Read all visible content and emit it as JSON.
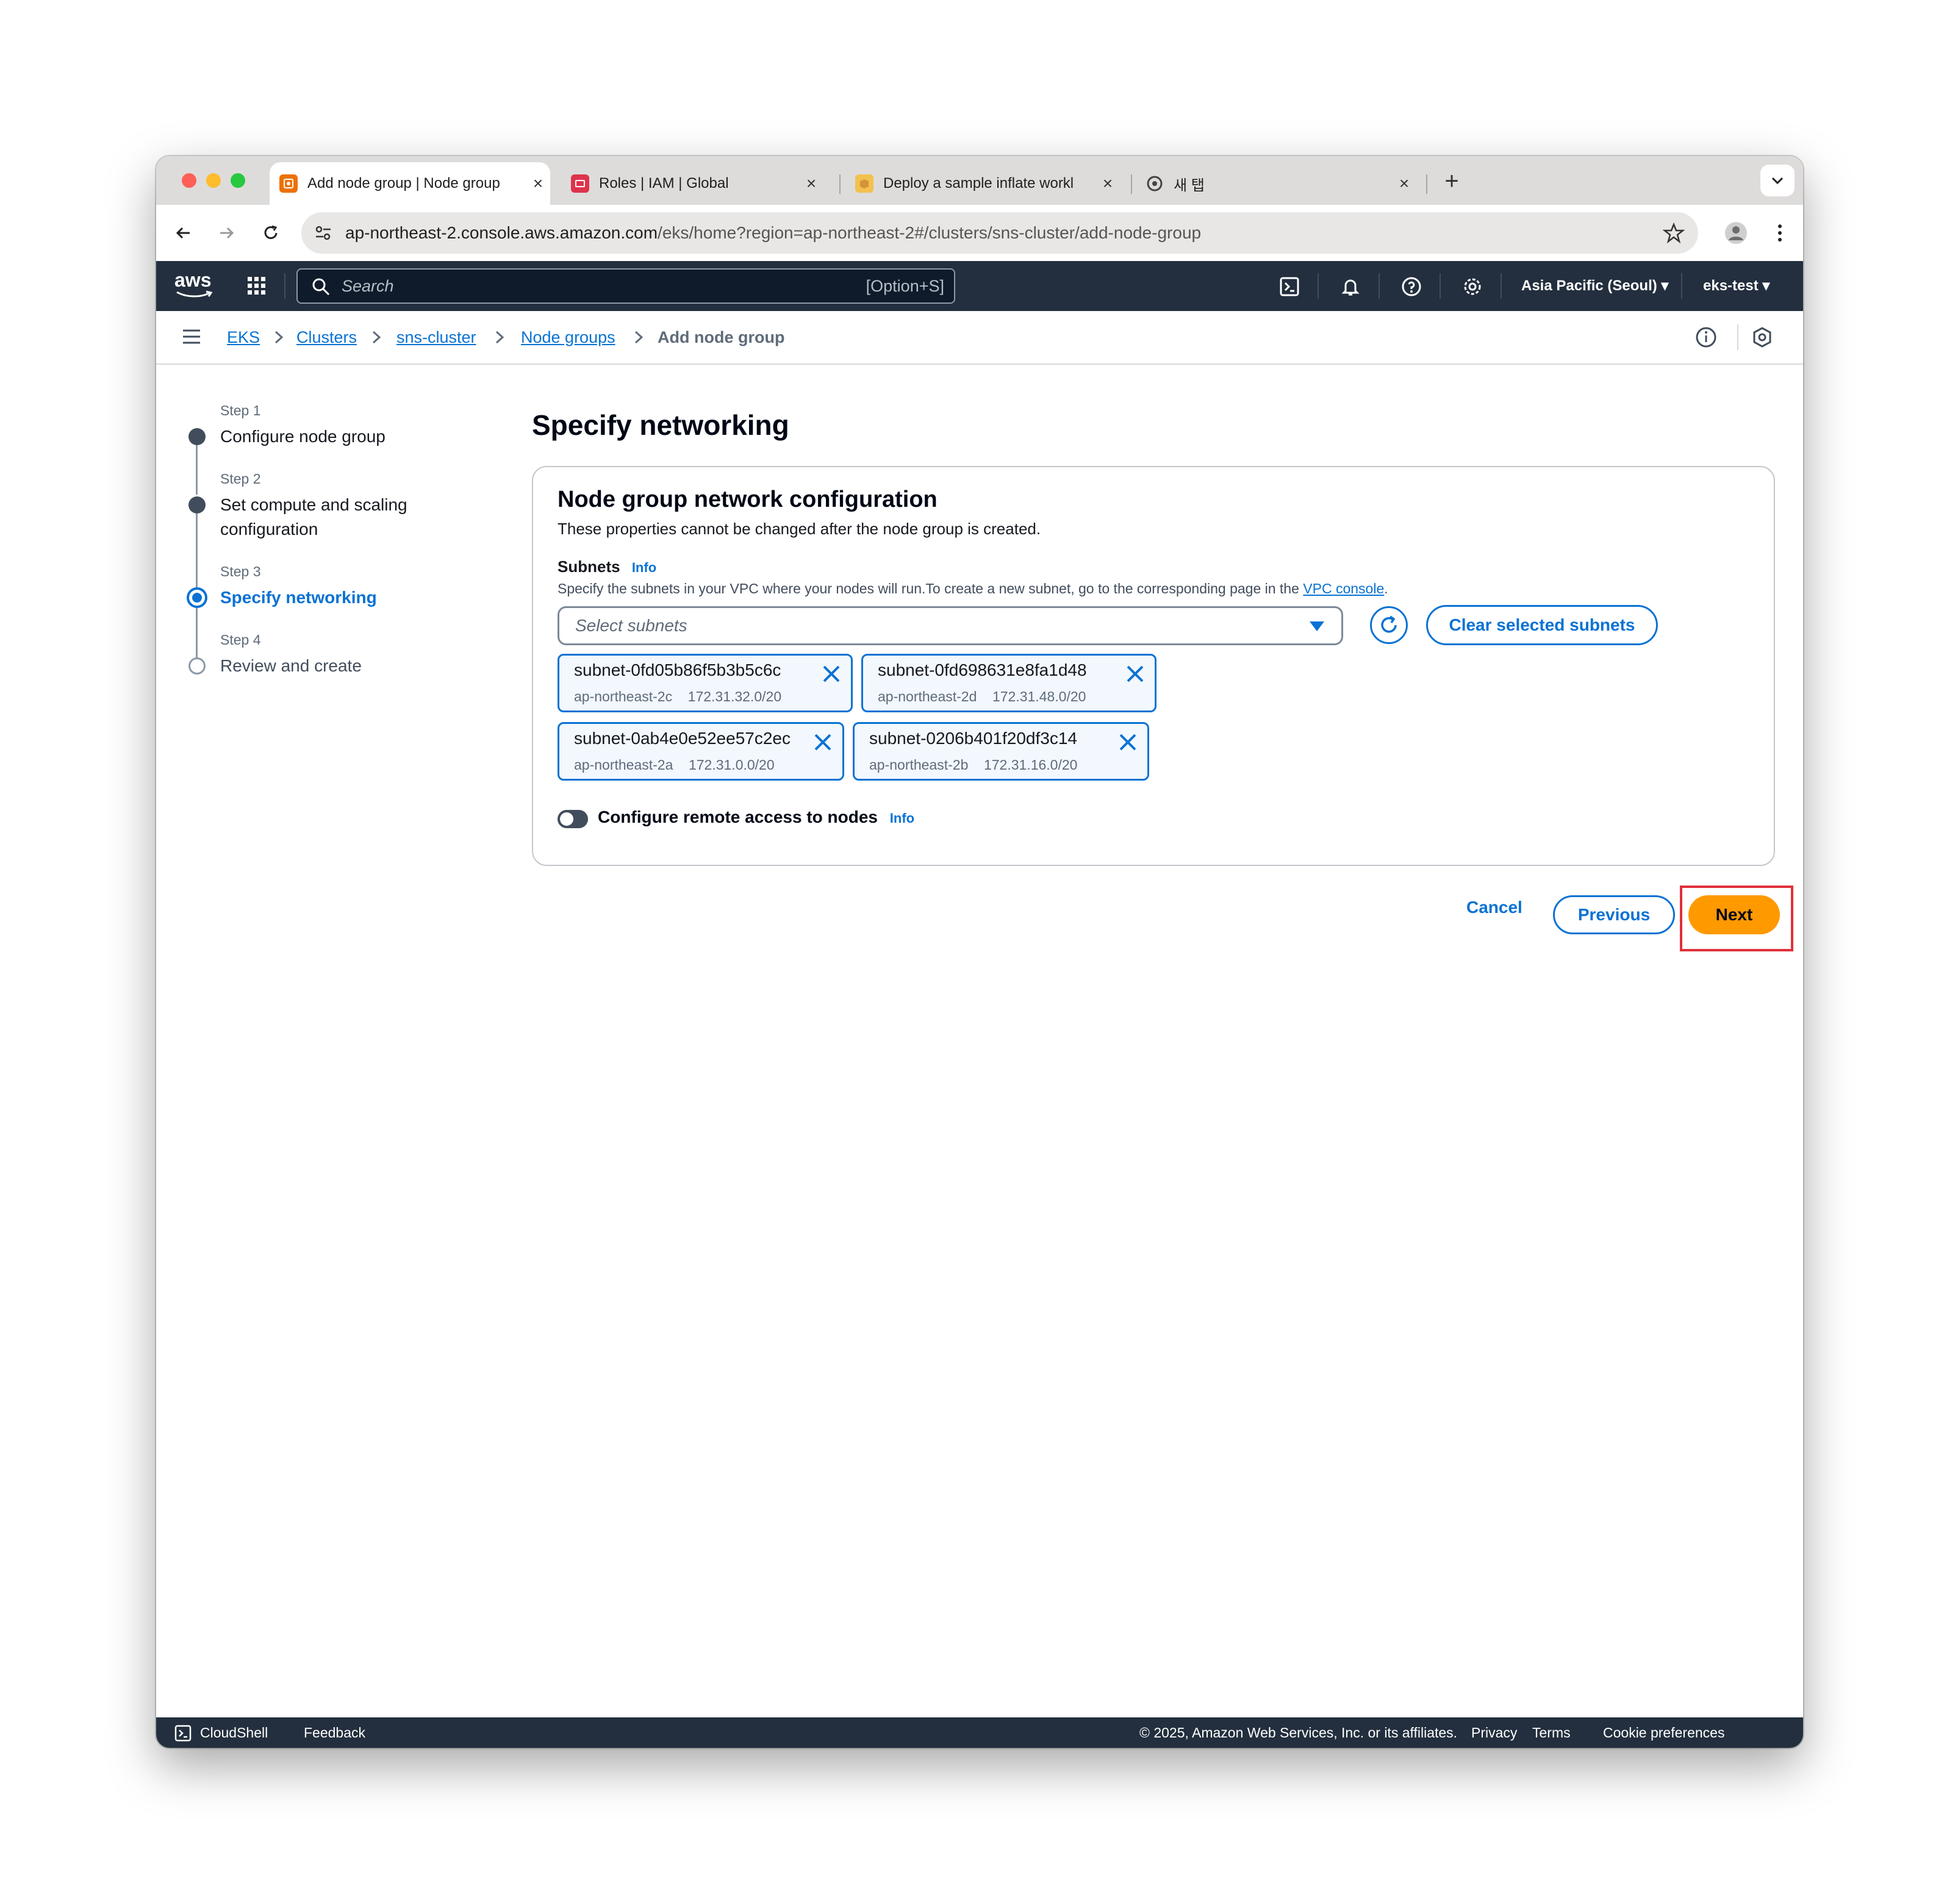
{
  "browser": {
    "tabs": [
      {
        "title": "Add node group | Node group",
        "active": true
      },
      {
        "title": "Roles | IAM | Global",
        "active": false
      },
      {
        "title": "Deploy a sample inflate workl",
        "active": false
      },
      {
        "title": "새 탭",
        "active": false
      }
    ],
    "url_host": "ap-northeast-2.console.aws.amazon.com",
    "url_path": "/eks/home?region=ap-northeast-2#/clusters/sns-cluster/add-node-group"
  },
  "aws_nav": {
    "logo": "aws",
    "search_placeholder": "Search",
    "search_shortcut": "[Option+S]",
    "region": "Asia Pacific (Seoul)",
    "account": "eks-test"
  },
  "breadcrumb": {
    "items": [
      "EKS",
      "Clusters",
      "sns-cluster",
      "Node groups"
    ],
    "current": "Add node group"
  },
  "steps": [
    {
      "label": "Step 1",
      "title": "Configure node group",
      "state": "done"
    },
    {
      "label": "Step 2",
      "title": "Set compute and scaling configuration",
      "state": "done"
    },
    {
      "label": "Step 3",
      "title": "Specify networking",
      "state": "current"
    },
    {
      "label": "Step 4",
      "title": "Review and create",
      "state": "pending"
    }
  ],
  "page_title": "Specify networking",
  "panel": {
    "heading": "Node group network configuration",
    "description": "These properties cannot be changed after the node group is created.",
    "subnets_label": "Subnets",
    "info": "Info",
    "subnets_help": "Specify the subnets in your VPC where your nodes will run.To create a new subnet, go to the corresponding page in the",
    "vpc_link": "VPC console",
    "select_placeholder": "Select subnets",
    "clear_button": "Clear selected subnets",
    "subnets": [
      {
        "id": "subnet-0fd05b86f5b3b5c6c",
        "az": "ap-northeast-2c",
        "cidr": "172.31.32.0/20"
      },
      {
        "id": "subnet-0fd698631e8fa1d48",
        "az": "ap-northeast-2d",
        "cidr": "172.31.48.0/20"
      },
      {
        "id": "subnet-0ab4e0e52ee57c2ec",
        "az": "ap-northeast-2a",
        "cidr": "172.31.0.0/20"
      },
      {
        "id": "subnet-0206b401f20df3c14",
        "az": "ap-northeast-2b",
        "cidr": "172.31.16.0/20"
      }
    ],
    "remote_access_label": "Configure remote access to nodes",
    "remote_access_enabled": false
  },
  "actions": {
    "cancel": "Cancel",
    "previous": "Previous",
    "next": "Next"
  },
  "footer": {
    "cloudshell": "CloudShell",
    "feedback": "Feedback",
    "copyright": "© 2025, Amazon Web Services, Inc. or its affiliates.",
    "privacy": "Privacy",
    "terms": "Terms",
    "cookies": "Cookie preferences"
  },
  "colors": {
    "accent": "#0972d3",
    "primary_button": "#ff9900",
    "nav_bg": "#232f3e",
    "highlight": "#e0303a"
  }
}
